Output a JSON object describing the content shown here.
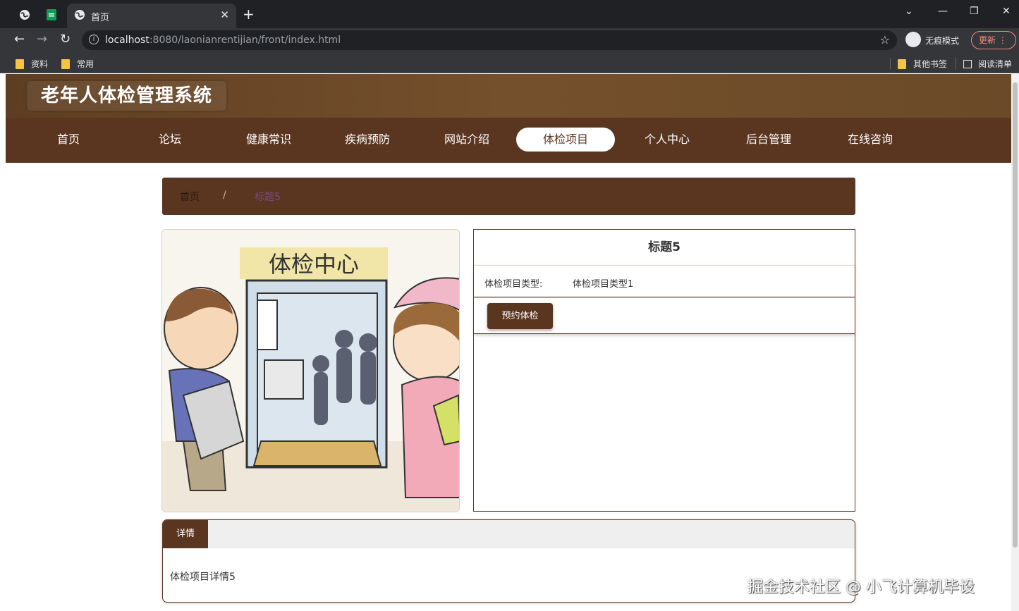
{
  "browser": {
    "tab_title": "首页",
    "url_host": "localhost",
    "url_path": ":8080/laonianrentijian/front/index.html",
    "incognito_label": "无痕模式",
    "update_label": "更新",
    "bookmarks": [
      "资料",
      "常用"
    ],
    "bookmarks_right": [
      "其他书签",
      "阅读清单"
    ]
  },
  "site": {
    "title": "老年人体检管理系统",
    "nav": [
      "首页",
      "论坛",
      "健康常识",
      "疾病预防",
      "网站介绍",
      "体检项目",
      "个人中心",
      "后台管理",
      "在线咨询"
    ],
    "active_nav": "体检项目"
  },
  "breadcrumb": {
    "home": "首页",
    "separator": "/",
    "current": "标题5"
  },
  "image": {
    "sign_text": "体检中心"
  },
  "item": {
    "title": "标题5",
    "type_label": "体检项目类型:",
    "type_value": "体检项目类型1",
    "book_button": "预约体检"
  },
  "detail": {
    "tab": "详情",
    "content": "体检项目详情5"
  },
  "watermark": "掘金技术社区 @ 小飞计算机毕设",
  "colors": {
    "brand": "#5a3520",
    "header": "#6a4a28",
    "active_nav_bg": "#ffffff"
  }
}
